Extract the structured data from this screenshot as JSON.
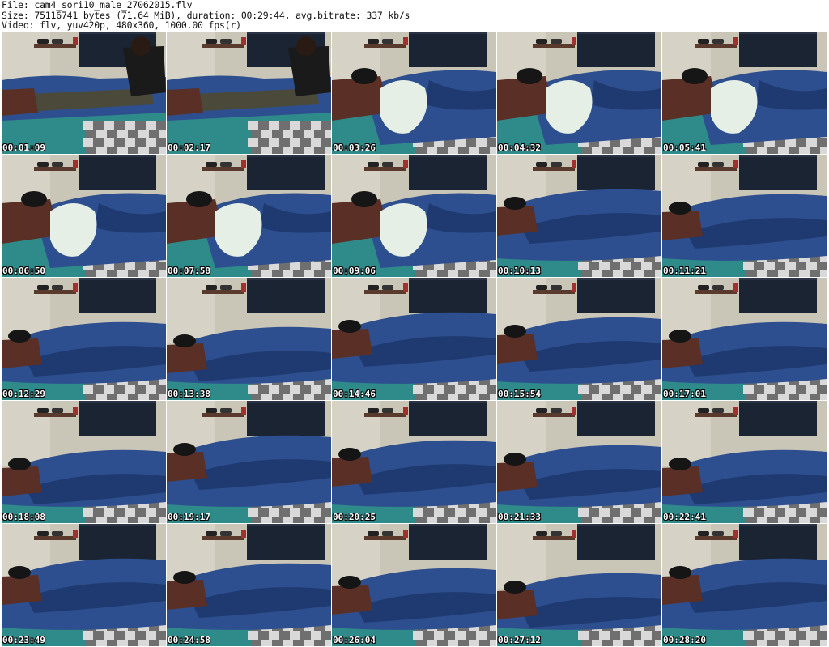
{
  "header": {
    "file": "File: cam4_sori10_male_27062015.flv",
    "size": "Size: 75116741 bytes (71.64 MiB), duration: 00:29:44, avg.bitrate: 337 kb/s",
    "video": "Video: flv, yuv420p, 480x360, 1000.00 fps(r)"
  },
  "thumbnails": [
    {
      "time": "00:01:09",
      "scene": "man-on-top"
    },
    {
      "time": "00:02:17",
      "scene": "man-on-top"
    },
    {
      "time": "00:03:26",
      "scene": "pillow"
    },
    {
      "time": "00:04:32",
      "scene": "pillow"
    },
    {
      "time": "00:05:41",
      "scene": "pillow"
    },
    {
      "time": "00:06:50",
      "scene": "pillow"
    },
    {
      "time": "00:07:58",
      "scene": "pillow"
    },
    {
      "time": "00:09:06",
      "scene": "pillow"
    },
    {
      "time": "00:10:13",
      "scene": "blanket"
    },
    {
      "time": "00:11:21",
      "scene": "blanket"
    },
    {
      "time": "00:12:29",
      "scene": "blanket"
    },
    {
      "time": "00:13:38",
      "scene": "blanket"
    },
    {
      "time": "00:14:46",
      "scene": "blanket"
    },
    {
      "time": "00:15:54",
      "scene": "blanket"
    },
    {
      "time": "00:17:01",
      "scene": "blanket"
    },
    {
      "time": "00:18:08",
      "scene": "blanket"
    },
    {
      "time": "00:19:17",
      "scene": "blanket"
    },
    {
      "time": "00:20:25",
      "scene": "blanket"
    },
    {
      "time": "00:21:33",
      "scene": "blanket"
    },
    {
      "time": "00:22:41",
      "scene": "blanket"
    },
    {
      "time": "00:23:49",
      "scene": "blanket"
    },
    {
      "time": "00:24:58",
      "scene": "blanket"
    },
    {
      "time": "00:26:04",
      "scene": "blanket"
    },
    {
      "time": "00:27:12",
      "scene": "blanket"
    },
    {
      "time": "00:28:20",
      "scene": "blanket"
    }
  ],
  "colors": {
    "wall": "#c9c6b8",
    "window": "#1b2433",
    "shelf": "#5a3a2c",
    "blanket": "#2d4f8f",
    "blanket_dark": "#1f3a70",
    "sheet_teal": "#2f8a8a",
    "sweater": "#5a2f26",
    "pants": "#4b4a3a",
    "pillow": "#e6efe6",
    "checker_light": "#d9d9d9",
    "checker_dark": "#6f6f6f"
  }
}
